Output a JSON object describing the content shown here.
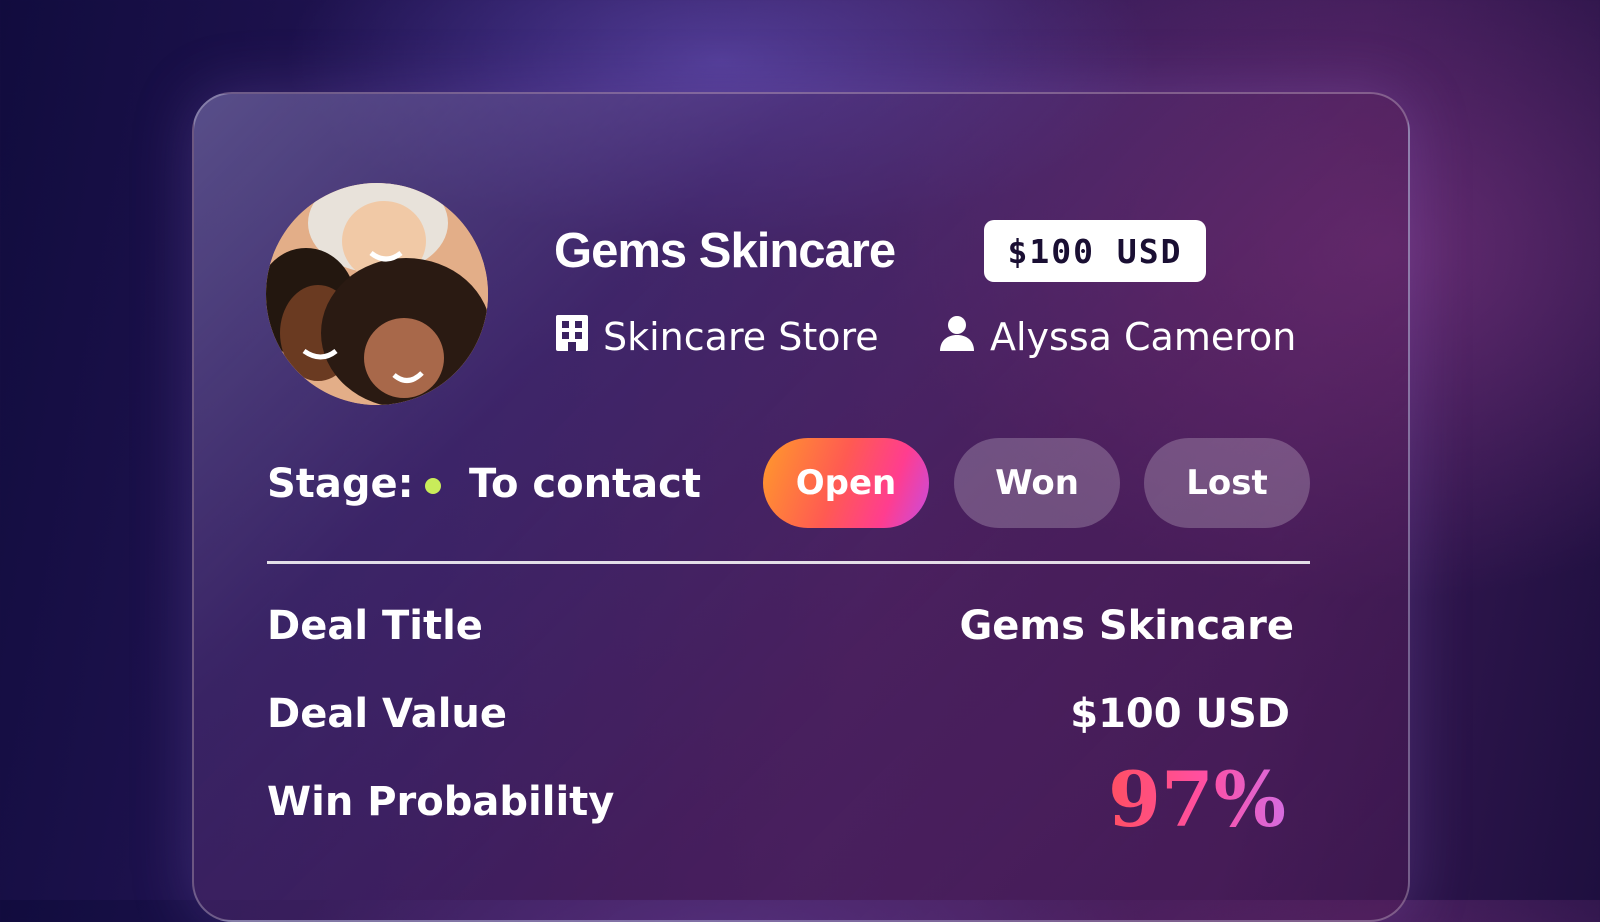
{
  "deal": {
    "name": "Gems Skincare",
    "price_badge": "$100 USD",
    "company": "Skincare Store",
    "owner": "Alyssa Cameron",
    "stage_label": "Stage:",
    "stage_value": "To contact",
    "stage_dot_color": "#c9ec5a",
    "status_buttons": [
      {
        "label": "Open",
        "active": true
      },
      {
        "label": "Won",
        "active": false
      },
      {
        "label": "Lost",
        "active": false
      }
    ],
    "details": [
      {
        "label": "Deal Title",
        "value": "Gems Skincare"
      },
      {
        "label": "Deal Value",
        "value": "$100 USD"
      },
      {
        "label": "Win Probability",
        "value": "97%"
      }
    ]
  },
  "icons": {
    "company": "building-icon",
    "owner": "person-icon",
    "avatar": "avatar-photo"
  },
  "colors": {
    "accent_gradient_start": "#ff9a2b",
    "accent_gradient_end": "#c74ce0",
    "badge_bg": "#ffffff"
  }
}
